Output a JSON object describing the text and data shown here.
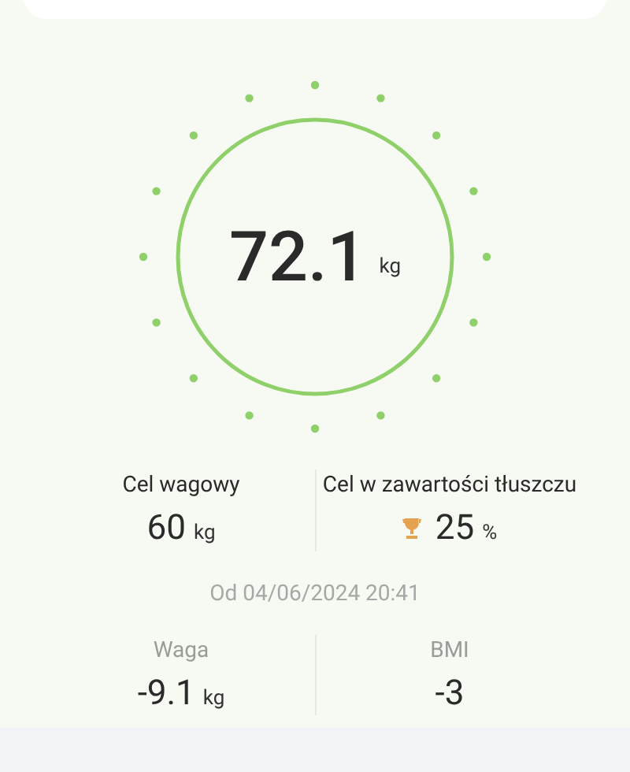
{
  "weight": {
    "value": "72.1",
    "unit": "kg"
  },
  "goals": [
    {
      "kind": "plain",
      "label": "Cel wagowy",
      "value": "60",
      "unit": "kg"
    },
    {
      "kind": "trophy",
      "label": "Cel w zawartości tłuszczu",
      "value": "25",
      "unit": "%"
    }
  ],
  "since": "Od 04/06/2024 20:41",
  "changes": [
    {
      "label": "Waga",
      "value": "-9.1",
      "unit": "kg"
    },
    {
      "label": "BMI",
      "value": "-3"
    }
  ]
}
